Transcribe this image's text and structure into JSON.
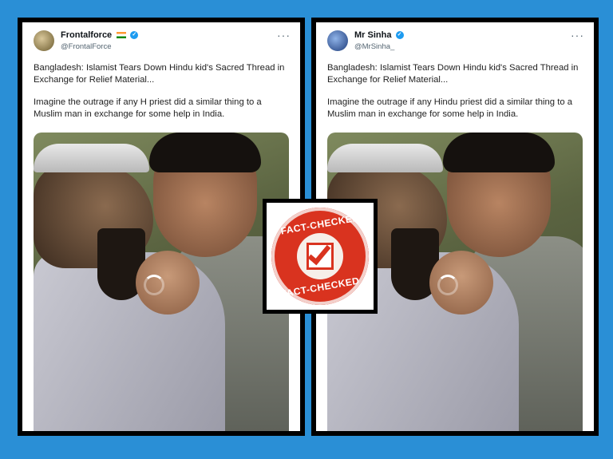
{
  "left_tweet": {
    "name": "Frontalforce",
    "handle": "@FrontalForce",
    "more_label": "···",
    "text_1": "Bangladesh: Islamist Tears Down Hindu kid's Sacred Thread in Exchange for Relief Material...",
    "text_2": "Imagine the outrage if any H priest did a similar thing to a Muslim man in exchange for some help in India."
  },
  "right_tweet": {
    "name": "Mr Sinha",
    "handle": "@MrSinha_",
    "more_label": "···",
    "text_1": "Bangladesh: Islamist Tears Down Hindu kid's Sacred Thread in Exchange for Relief Material...",
    "text_2": "Imagine the outrage if any Hindu priest did a similar thing to a Muslim man in exchange for some help in India."
  },
  "stamp": {
    "top_text": "FACT-CHECKED",
    "bottom_text": "FACT-CHECKED",
    "color": "#d9331f"
  },
  "colors": {
    "background": "#2a8fd6",
    "verified": "#1d9bf0"
  }
}
